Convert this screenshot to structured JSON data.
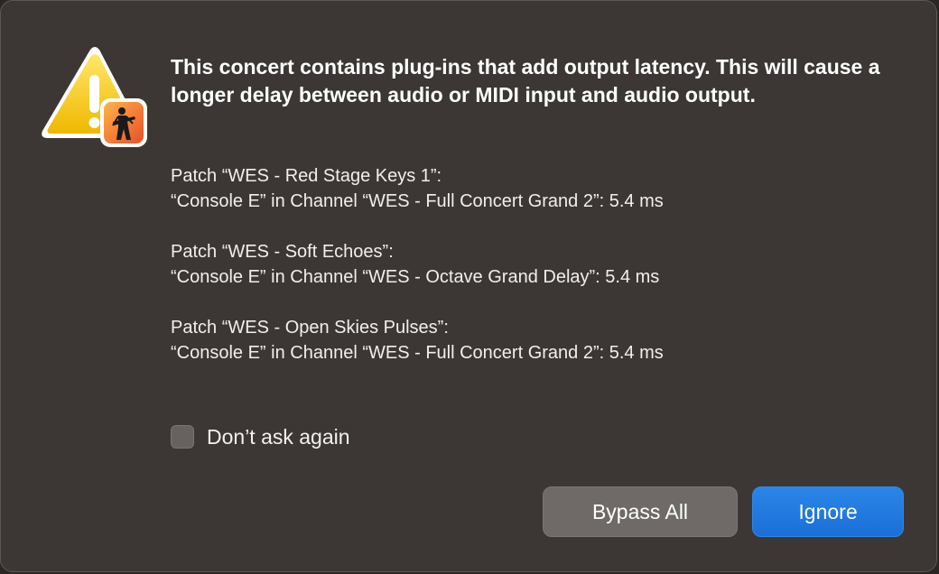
{
  "alert": {
    "icon": "warning-triangle-icon",
    "app_badge_icon": "mainstage-app-icon",
    "headline": "This concert contains plug-ins that add output latency.  This will cause a longer delay between audio or MIDI input and audio output.",
    "patches": [
      {
        "patch": "Patch “WES - Red Stage Keys 1”:",
        "detail": "“Console E” in Channel “WES - Full Concert Grand 2”: 5.4 ms"
      },
      {
        "patch": "Patch “WES - Soft Echoes”:",
        "detail": "“Console E” in Channel “WES - Octave Grand Delay”: 5.4 ms"
      },
      {
        "patch": "Patch “WES - Open Skies Pulses”:",
        "detail": "“Console E” in Channel “WES - Full Concert Grand 2”: 5.4 ms"
      }
    ],
    "dont_ask_again": {
      "label": "Don’t ask again",
      "checked": false
    },
    "buttons": {
      "bypass_all": "Bypass All",
      "ignore": "Ignore"
    },
    "colors": {
      "background": "#3c3734",
      "primary_button": "#1b6fd8",
      "secondary_button": "#6f6a67",
      "warning_yellow": "#f5c518"
    }
  }
}
